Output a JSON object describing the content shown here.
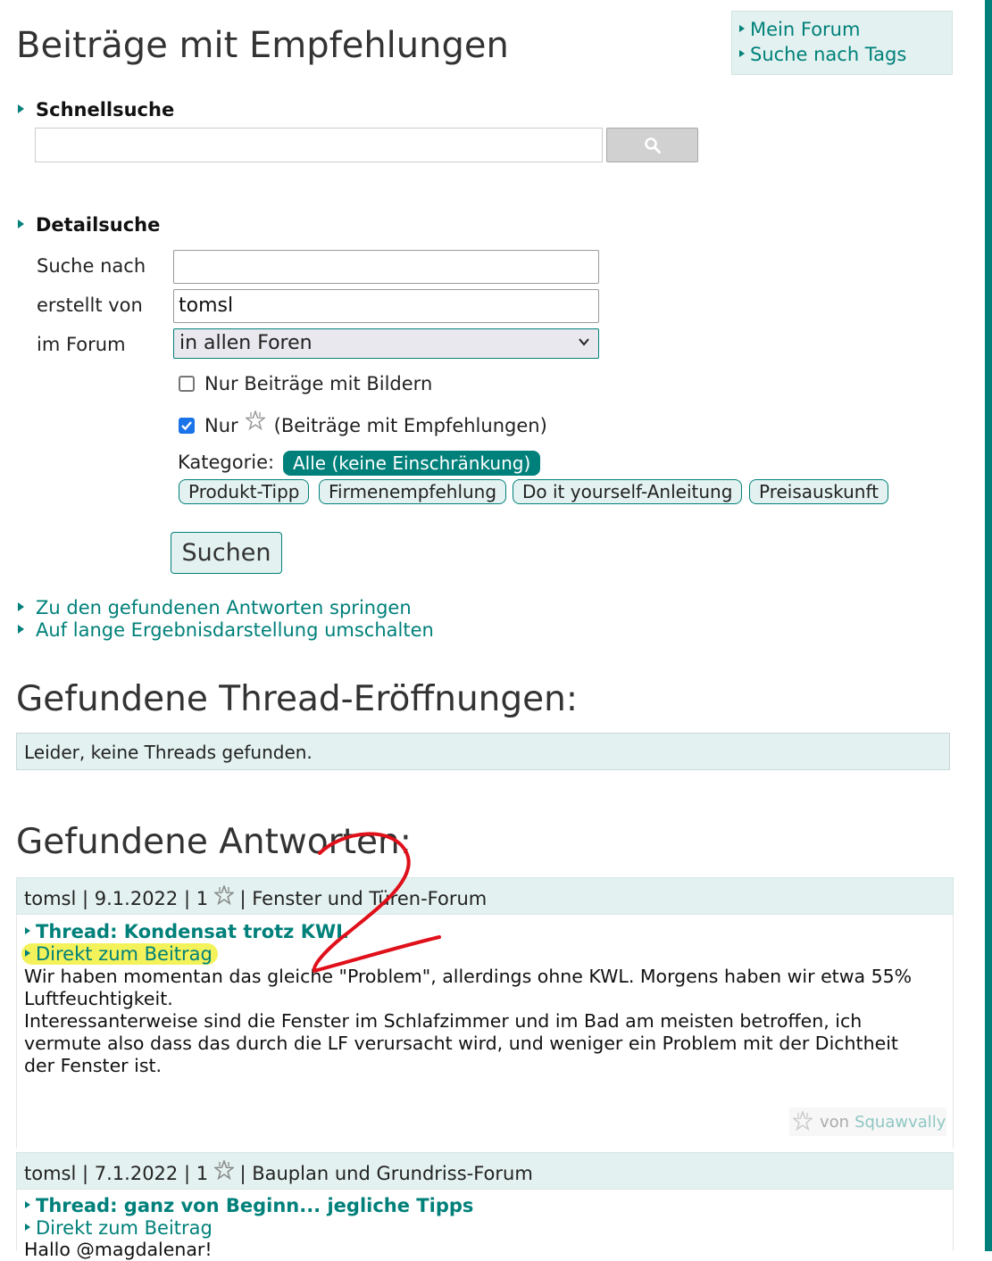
{
  "page_title": "Beiträge mit Empfehlungen",
  "side_links": [
    "Mein Forum",
    "Suche nach Tags"
  ],
  "quick_search": {
    "heading": "Schnellsuche",
    "value": ""
  },
  "detail_search": {
    "heading": "Detailsuche",
    "label_query": "Suche nach",
    "query_value": "",
    "label_author": "erstellt von",
    "author_value": "tomsl",
    "label_forum": "im Forum",
    "forum_value": "in allen Foren",
    "cb_images_label": "Nur Beiträge mit Bildern",
    "cb_images_checked": false,
    "cb_recommend_prefix": "Nur",
    "cb_recommend_suffix": "(Beiträge mit Empfehlungen)",
    "cb_recommend_checked": true,
    "category_label": "Kategorie:",
    "categories": [
      "Alle (keine Einschränkung)",
      "Produkt-Tipp",
      "Firmenempfehlung",
      "Do it yourself-Anleitung",
      "Preisauskunft"
    ],
    "active_category": "Alle (keine Einschränkung)",
    "submit_label": "Suchen"
  },
  "nav_links": [
    "Zu den gefundenen Antworten springen",
    "Auf lange Ergebnisdarstellung umschalten"
  ],
  "threads_section": {
    "title": "Gefundene Thread-Eröffnungen:",
    "empty_message": "Leider, keine Threads gefunden."
  },
  "answers_section": {
    "title": "Gefundene Antworten:",
    "results": [
      {
        "author": "tomsl",
        "date": "9.1.2022",
        "recommendations": "1",
        "forum": "Fenster und Türen-Forum",
        "thread_label": "Thread: Kondensat trotz KWL",
        "direct_label": "Direkt zum Beitrag",
        "text_lines": [
          "Wir haben momentan das gleiche \"Problem\", allerdings ohne KWL. Morgens haben wir etwa 55%",
          "Luftfeuchtigkeit.",
          "Interessanterweise sind die Fenster im Schlafzimmer und im Bad am meisten betroffen, ich",
          "vermute also dass das durch die LF verursacht wird, und weniger ein Problem mit der Dichtheit",
          "der Fenster ist."
        ],
        "recommended_by_prefix": "von",
        "recommended_by_user": "Squawvally"
      },
      {
        "author": "tomsl",
        "date": "7.1.2022",
        "recommendations": "1",
        "forum": "Bauplan und Grundriss-Forum",
        "thread_label": "Thread: ganz von Beginn... jegliche Tipps",
        "direct_label": "Direkt zum Beitrag",
        "text_start": "Hallo @magdalenar!"
      }
    ]
  },
  "annotation": {
    "number": "2",
    "color": "#e0101a",
    "highlight_color": "#f4f25b"
  },
  "colors": {
    "accent": "#00807a",
    "panel_bg": "#e3f2f0"
  }
}
